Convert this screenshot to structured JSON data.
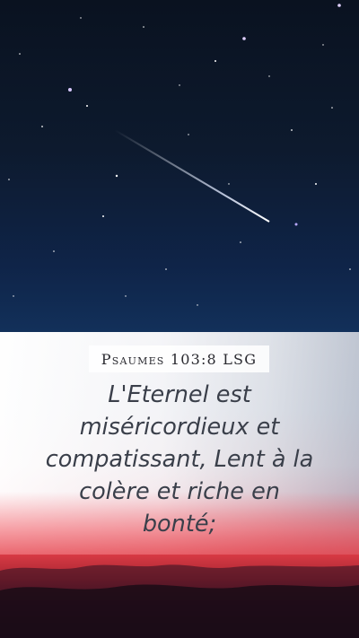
{
  "reference": "Psaumes 103:8 LSG",
  "verse_lines": [
    "L'Eternel est",
    "miséricordieux et",
    "compatissant, Lent à la",
    "colère et riche en",
    "bonté;"
  ],
  "colors": {
    "sky_top": "#0a1220",
    "sky_bottom": "#12305a",
    "sunset_red": "#e14d55",
    "text": "#3a3f4a"
  }
}
